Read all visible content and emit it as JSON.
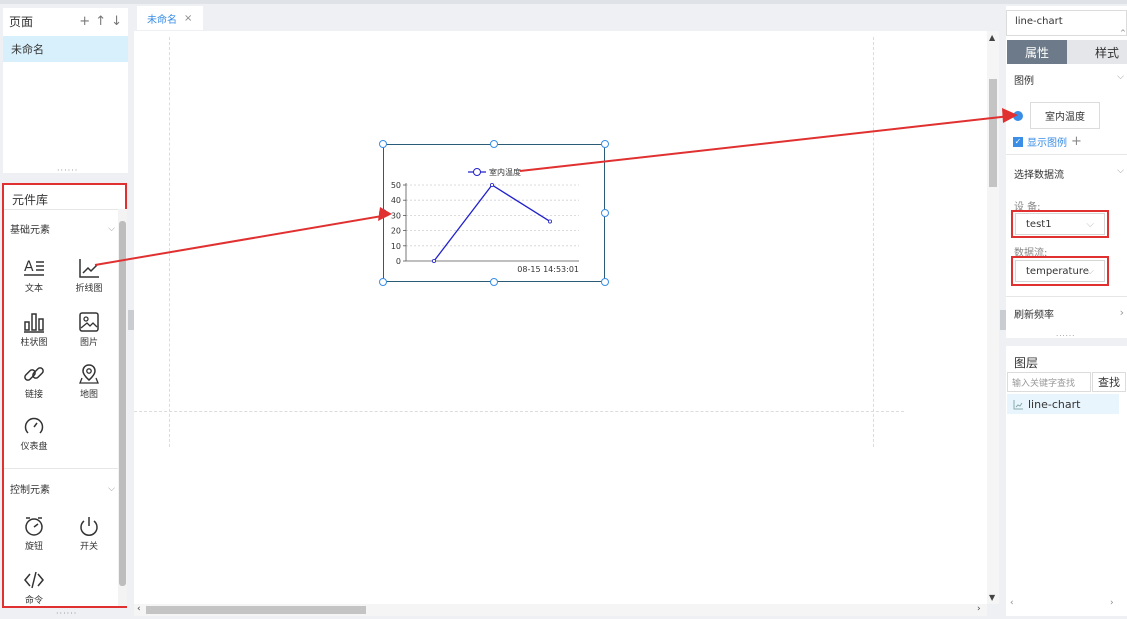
{
  "pages": {
    "title": "页面",
    "actions": {
      "add": "+",
      "up": "↑",
      "down": "↓"
    },
    "items": [
      "未命名"
    ]
  },
  "library": {
    "title": "元件库",
    "groups": [
      {
        "label": "基础元素",
        "items": [
          "文本",
          "折线图",
          "柱状图",
          "图片",
          "链接",
          "地图",
          "仪表盘"
        ]
      },
      {
        "label": "控制元素",
        "items": [
          "旋钮",
          "开关",
          "命令"
        ]
      }
    ]
  },
  "editor": {
    "tab": "未命名",
    "tab_close": "×"
  },
  "widget_chart": {
    "legend": "室内温度",
    "y_ticks": [
      "50",
      "40",
      "30",
      "20",
      "10",
      "0"
    ],
    "x_label": "08-15 14:53:01"
  },
  "chart_data": {
    "type": "line",
    "title": "",
    "legend": [
      "室内温度"
    ],
    "series": [
      {
        "name": "室内温度",
        "values": [
          0,
          50,
          26
        ]
      }
    ],
    "x": [
      "",
      "",
      "08-15 14:53:01"
    ],
    "ylim": [
      0,
      50
    ],
    "yticks": [
      0,
      10,
      20,
      30,
      40,
      50
    ],
    "grid": true,
    "legend_position": "top",
    "line_color": "#2222cc"
  },
  "props": {
    "component_name": "line-chart",
    "tabs": [
      "属性",
      "样式"
    ],
    "legend_section": "图例",
    "legend_item": "室内温度",
    "show_legend": "显示图例",
    "show_legend_add": "+",
    "datastream_section": "选择数据流",
    "device_label": "设 备:",
    "device_value": "test1",
    "stream_label": "数据流:",
    "stream_value": "temperature",
    "refresh_section": "刷新频率"
  },
  "layers": {
    "title": "图层",
    "search_placeholder": "输入关键字查找",
    "search_button": "查找",
    "items": [
      "line-chart"
    ]
  },
  "colors": {
    "accent": "#3a8ee6",
    "tab_active": "#6d7a89",
    "highlight": "#e8f5fd",
    "annotation": "#e03030"
  }
}
